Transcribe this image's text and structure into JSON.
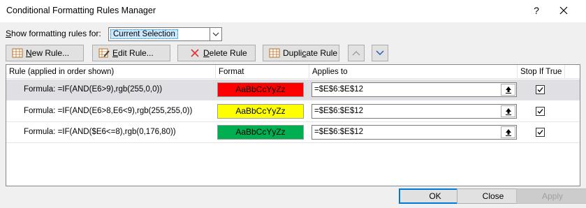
{
  "window": {
    "title": "Conditional Formatting Rules Manager",
    "help": "?"
  },
  "show_rules": {
    "label_prefix": "S",
    "label_rest": "how formatting rules for:",
    "value": "Current Selection"
  },
  "toolbar": {
    "new_rule": {
      "prefix": "N",
      "rest": "ew Rule..."
    },
    "edit_rule": {
      "prefix": "E",
      "rest": "dit Rule..."
    },
    "delete_rule": {
      "prefix": "D",
      "rest": "elete Rule"
    },
    "duplicate_rule": {
      "pre": "Dupli",
      "mid": "c",
      "post": "ate Rule"
    }
  },
  "grid": {
    "headers": [
      "Rule (applied in order shown)",
      "Format",
      "Applies to",
      "Stop If True"
    ],
    "rows": [
      {
        "rule": "Formula: =IF(AND(E6>9),rgb(255,0,0))",
        "format_sample": "AaBbCcYyZz",
        "format_color": "#ff0000",
        "applies_to": "=$E$6:$E$12",
        "stop_if_true": true,
        "selected": true
      },
      {
        "rule": "Formula: =IF(AND(E6>8,E6<9),rgb(255,255,0))",
        "format_sample": "AaBbCcYyZz",
        "format_color": "#ffff00",
        "applies_to": "=$E$6:$E$12",
        "stop_if_true": true,
        "selected": false
      },
      {
        "rule": "Formula: =IF(AND($E6<=8),rgb(0,176,80))",
        "format_sample": "AaBbCcYyZz",
        "format_color": "#00b050",
        "applies_to": "=$E$6:$E$12",
        "stop_if_true": true,
        "selected": false
      }
    ]
  },
  "buttons": {
    "ok": "OK",
    "close": "Close",
    "apply": "Apply"
  },
  "icons": [
    "close-icon",
    "dropdown-arrow-icon",
    "new-rule-icon",
    "edit-rule-icon",
    "delete-x-icon",
    "duplicate-rule-icon",
    "move-up-icon",
    "move-down-icon",
    "collapse-dialog-icon",
    "checkbox-check-icon"
  ]
}
